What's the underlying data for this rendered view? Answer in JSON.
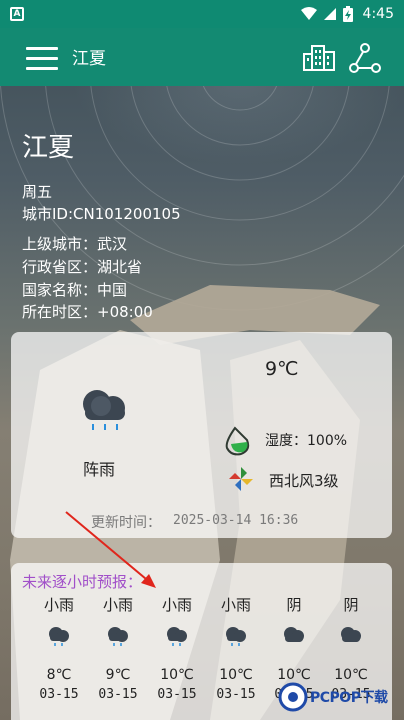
{
  "status_bar": {
    "app_icon_letter": "A",
    "time": "4:45",
    "icons": [
      "wifi-icon",
      "signal-icon",
      "battery-charging-icon"
    ]
  },
  "app_bar": {
    "title": "江夏",
    "icons": [
      "menu-icon",
      "city-buildings-icon",
      "share-icon"
    ]
  },
  "location": {
    "city": "江夏",
    "weekday": "周五",
    "city_id": "城市ID:CN101200105",
    "parent_city": "上级城市：武汉",
    "province": "行政省区：湖北省",
    "country": "国家名称：中国",
    "timezone": "所在时区：+08:00"
  },
  "now": {
    "temperature": "9℃",
    "condition": "阵雨",
    "humidity": "湿度：100%",
    "wind": "西北风3级",
    "update_label": "更新时间：",
    "update_time": "2025-03-14 16:36",
    "icons": [
      "rain-cloud-icon",
      "humidity-icon",
      "wind-icon"
    ]
  },
  "hourly": {
    "title": "未来逐小时预报：",
    "items": [
      {
        "condition": "小雨",
        "temp": "8℃",
        "date": "03-15",
        "icon": "light-rain-icon"
      },
      {
        "condition": "小雨",
        "temp": "9℃",
        "date": "03-15",
        "icon": "light-rain-icon"
      },
      {
        "condition": "小雨",
        "temp": "10℃",
        "date": "03-15",
        "icon": "light-rain-icon"
      },
      {
        "condition": "小雨",
        "temp": "10℃",
        "date": "03-15",
        "icon": "light-rain-icon"
      },
      {
        "condition": "阴",
        "temp": "10℃",
        "date": "03-15",
        "icon": "overcast-icon"
      },
      {
        "condition": "阴",
        "temp": "10℃",
        "date": "03-15",
        "icon": "overcast-icon"
      }
    ]
  },
  "watermark": {
    "text": "PCPOP下载"
  },
  "colors": {
    "app_bar": "#138a72",
    "hourly_title": "#a14fc9",
    "annotation_arrow": "#e0261c"
  }
}
